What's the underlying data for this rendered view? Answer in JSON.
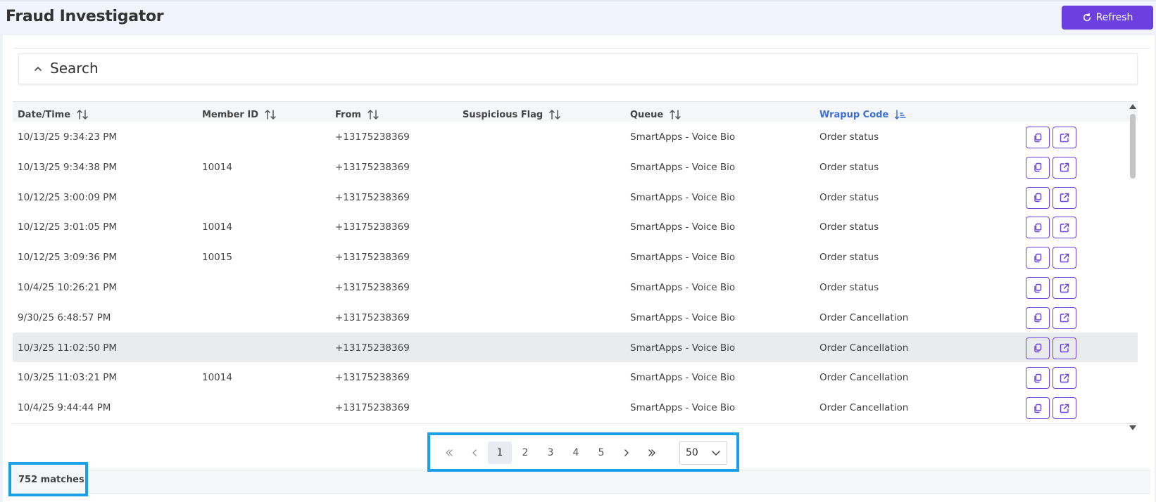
{
  "header": {
    "title": "Fraud Investigator",
    "refresh_label": "Refresh"
  },
  "search": {
    "title": "Search"
  },
  "table": {
    "columns": [
      {
        "label": "Date/Time",
        "sort": "none"
      },
      {
        "label": "Member ID",
        "sort": "none"
      },
      {
        "label": "From",
        "sort": "none"
      },
      {
        "label": "Suspicious Flag",
        "sort": "none"
      },
      {
        "label": "Queue",
        "sort": "none"
      },
      {
        "label": "Wrapup Code",
        "sort": "ascending"
      }
    ],
    "rows": [
      {
        "datetime": "10/13/25 9:34:23 PM",
        "member_id": "",
        "from": "+13175238369",
        "flag": "",
        "queue": "SmartApps - Voice Bio",
        "wrapup": "Order status"
      },
      {
        "datetime": "10/13/25 9:34:38 PM",
        "member_id": "10014",
        "from": "+13175238369",
        "flag": "",
        "queue": "SmartApps - Voice Bio",
        "wrapup": "Order status"
      },
      {
        "datetime": "10/12/25 3:00:09 PM",
        "member_id": "",
        "from": "+13175238369",
        "flag": "",
        "queue": "SmartApps - Voice Bio",
        "wrapup": "Order status"
      },
      {
        "datetime": "10/12/25 3:01:05 PM",
        "member_id": "10014",
        "from": "+13175238369",
        "flag": "",
        "queue": "SmartApps - Voice Bio",
        "wrapup": "Order status"
      },
      {
        "datetime": "10/12/25 3:09:36 PM",
        "member_id": "10015",
        "from": "+13175238369",
        "flag": "",
        "queue": "SmartApps - Voice Bio",
        "wrapup": "Order status"
      },
      {
        "datetime": "10/4/25 10:26:21 PM",
        "member_id": "",
        "from": "+13175238369",
        "flag": "",
        "queue": "SmartApps - Voice Bio",
        "wrapup": "Order status"
      },
      {
        "datetime": "9/30/25 6:48:57 PM",
        "member_id": "",
        "from": "+13175238369",
        "flag": "",
        "queue": "SmartApps - Voice Bio",
        "wrapup": "Order Cancellation"
      },
      {
        "datetime": "10/3/25 11:02:50 PM",
        "member_id": "",
        "from": "+13175238369",
        "flag": "",
        "queue": "SmartApps - Voice Bio",
        "wrapup": "Order Cancellation"
      },
      {
        "datetime": "10/3/25 11:03:21 PM",
        "member_id": "10014",
        "from": "+13175238369",
        "flag": "",
        "queue": "SmartApps - Voice Bio",
        "wrapup": "Order Cancellation"
      },
      {
        "datetime": "10/4/25 9:44:44 PM",
        "member_id": "",
        "from": "+13175238369",
        "flag": "",
        "queue": "SmartApps - Voice Bio",
        "wrapup": "Order Cancellation"
      }
    ],
    "highlighted_row": 7,
    "row_actions": [
      "copy-icon",
      "open-external-icon"
    ]
  },
  "pagination": {
    "pages": [
      "1",
      "2",
      "3",
      "4",
      "5"
    ],
    "current_page": "1",
    "page_size": "50"
  },
  "footer": {
    "matches": "752 matches"
  },
  "colors": {
    "accent": "#6c3fe0",
    "active_sort": "#3d6fd8",
    "annotation_box": "#1aa0e6",
    "header_bg": "#f1f4fc",
    "row_highlight": "#e9ebee"
  }
}
